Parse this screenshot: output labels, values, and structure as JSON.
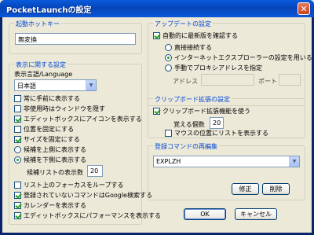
{
  "window": {
    "title": "PocketLaunchの設定",
    "close": "✕"
  },
  "hotkey": {
    "legend": "起動ホットキー",
    "value": "無変換"
  },
  "display": {
    "legend": "表示に関する設定",
    "language_label": "表示言語/Language",
    "language_value": "日本語",
    "always_on_top": "常に手前に表示する",
    "hide_when_inactive": "非使用時はウィンドウを隠す",
    "show_icon_in_editbox": "エディットボックスにアイコンを表示する",
    "fixed_position": "位置を固定にする",
    "fixed_size": "サイズを固定にする",
    "candidates_above": "候補を上側に表示する",
    "candidates_below": "候補を下側に表示する",
    "candidate_count_label": "候補リストの表示数",
    "candidate_count_value": "20",
    "loop_focus": "リスト上のフォーカスをループする",
    "google_search": "登録されていないコマンドはGoogle検索する",
    "show_calendar": "カレンダーを表示する",
    "show_performance": "エディットボックスにパフォーマンスを表示する"
  },
  "update": {
    "legend": "アップデートの設定",
    "auto_check": "自動的に最新版を確認する",
    "direct": "直接接続する",
    "use_ie": "インターネットエクスプローラーの設定を用いる",
    "manual_proxy": "手動でプロキシアドレスを指定",
    "address_label": "アドレス",
    "address_value": "",
    "port_label": "ポート",
    "port_value": ""
  },
  "clipboard": {
    "legend": "クリップボード拡張の設定",
    "use": "クリップボード拡張機能を使う",
    "count_label": "覚える個数",
    "count_value": "20",
    "show_at_mouse": "マウスの位置にリストを表示する"
  },
  "commands": {
    "legend": "登録コマンドの再編集",
    "selected": "EXPLZH",
    "edit_button": "修正",
    "delete_button": "削除"
  },
  "footer": {
    "ok": "OK",
    "cancel": "キャンセル"
  }
}
